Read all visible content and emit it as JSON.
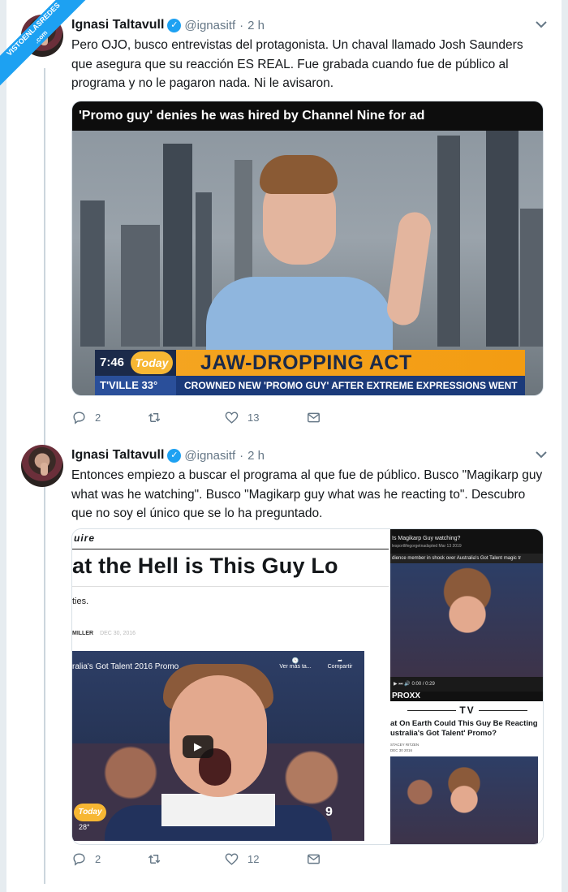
{
  "watermark": {
    "line1": "VISTOENLASREDES",
    "line2": ".com"
  },
  "tweets": [
    {
      "name": "Ignasi Taltavull",
      "handle": "@ignasitf",
      "dot": "·",
      "time": "2 h",
      "text": "Pero OJO, busco entrevistas del protagonista. Un chaval llamado Josh Saunders que asegura que su reacción ES REAL. Fue grabada cuando fue de público al programa y no le pagaron nada. Ni le avisaron.",
      "media": {
        "headline": "'Promo guy' denies he was hired by Channel Nine for ad",
        "clock": "7:46",
        "show_logo": "Today",
        "main_caption": "JAW-DROPPING ACT",
        "city_temp": "T'VILLE 33°",
        "sub_caption": "CROWNED NEW 'PROMO GUY' AFTER EXTREME EXPRESSIONS WENT VIRAL"
      },
      "replies": "2",
      "retweets": "",
      "likes": "13"
    },
    {
      "name": "Ignasi Taltavull",
      "handle": "@ignasitf",
      "dot": "·",
      "time": "2 h",
      "text": "Entonces empiezo a buscar el programa al que fue de público. Busco \"Magikarp guy what was he watching\". Busco \"Magikarp guy what was he reacting to\". Descubro que no soy el único que se lo ha preguntado.",
      "media": {
        "left": {
          "brand": "uire",
          "title": "at the Hell is This Guy Lo",
          "dek": "ties.",
          "byline": "MILLER",
          "date": "DEC 30, 2016",
          "video_title": "ralia's Got Talent 2016 Promo",
          "watch_later": "Ver más ta...",
          "share": "Compartir",
          "play": "▶",
          "show_logo": "Today",
          "temp": "28°",
          "channel": "9"
        },
        "right": {
          "video_title": "Is Magikarp Guy watching?",
          "uploader": "lesportlifegorgetnadspted   Mar 13 2019",
          "strip": "dience member in shock over Australia's Got Talent magic tr",
          "player_time": "0:00 / 0:29",
          "site": "PROXX",
          "category": "TV",
          "headline": "at On Earth Could This Guy Be Reacting ustralia's Got Talent' Promo?",
          "byline": "STACEY RITZEN",
          "date": "DEC 30 2016"
        }
      },
      "replies": "2",
      "retweets": "",
      "likes": "12"
    }
  ]
}
